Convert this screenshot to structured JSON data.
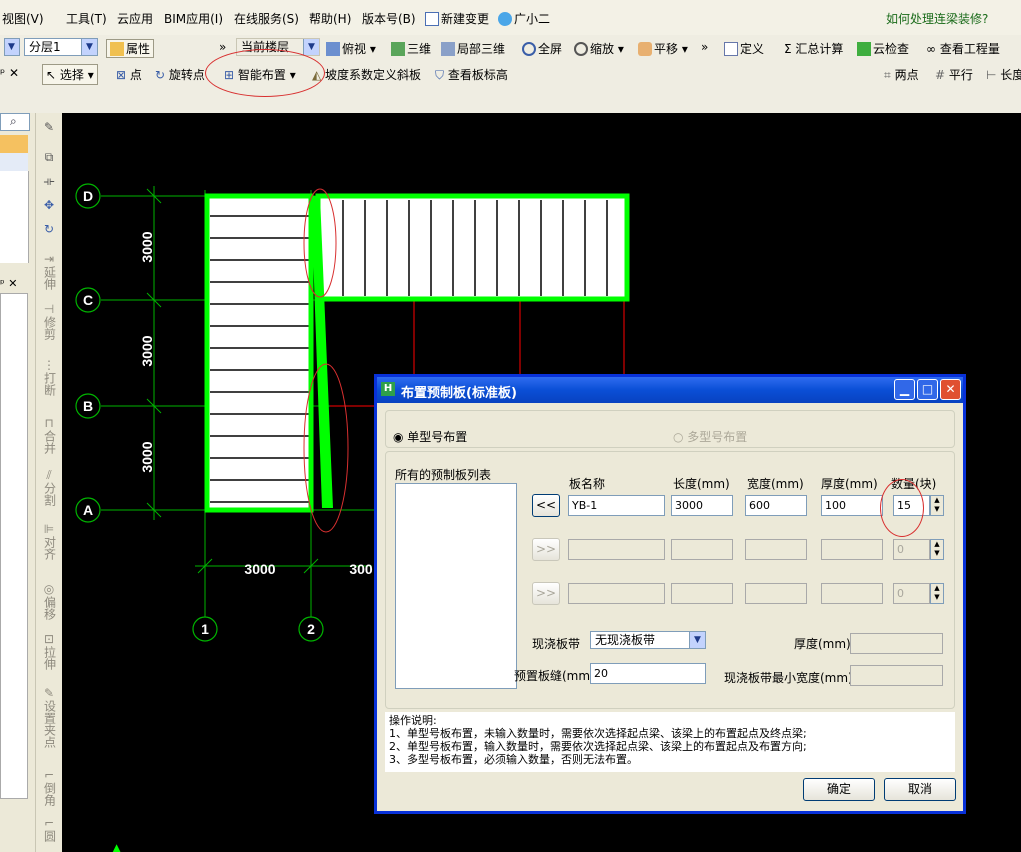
{
  "menu": {
    "items": [
      "视图(V)",
      "工具(T)",
      "云应用",
      "BIM应用(I)",
      "在线服务(S)",
      "帮助(H)",
      "版本号(B)",
      "新建变更",
      "广小二"
    ],
    "help_link": "如何处理连梁装修?"
  },
  "toolbar1": {
    "floor": "分层1",
    "properties": "属性",
    "current_floor": "当前楼层",
    "view_buttons": [
      "俯视",
      "三维",
      "局部三维",
      "全屏",
      "缩放",
      "平移"
    ],
    "right_buttons": [
      "定义",
      "汇总计算",
      "云检查",
      "查看工程量"
    ]
  },
  "toolbar2": {
    "select": "选择",
    "tools": [
      "点",
      "旋转点",
      "智能布置",
      "坡度系数定义斜板",
      "查看板标高"
    ],
    "right_tools": [
      "两点",
      "平行",
      "长度"
    ]
  },
  "side_tools": [
    "延伸",
    "修剪",
    "打断",
    "合并",
    "分割",
    "对齐",
    "偏移",
    "拉伸",
    "设置夹点",
    "倒角",
    "圆"
  ],
  "drawing": {
    "axes": [
      "D",
      "C",
      "B",
      "A",
      "1",
      "2"
    ],
    "dim_vertical": [
      "3000",
      "3000",
      "3000"
    ],
    "dim_horizontal": [
      "3000",
      "300"
    ]
  },
  "dialog": {
    "title": "布置预制板(标准板)",
    "single_mode": "单型号布置",
    "multi_mode": "多型号布置",
    "list_title": "所有的预制板列表",
    "col_name": "板名称",
    "col_length": "长度(mm)",
    "col_width": "宽度(mm)",
    "col_thickness": "厚度(mm)",
    "col_count": "数量(块)",
    "row1": {
      "btn": "<<",
      "name": "YB-1",
      "length": "3000",
      "width": "600",
      "thickness": "100",
      "count": "15"
    },
    "row2": {
      "btn": ">>",
      "count": "0"
    },
    "row3": {
      "btn": ">>",
      "count": "0"
    },
    "cast_band_label": "现浇板带",
    "cast_band_value": "无现浇板带",
    "thickness_label": "厚度(mm)",
    "gap_label": "预置板缝(mm)",
    "gap_value": "20",
    "min_width_label": "现浇板带最小宽度(mm)",
    "instructions": [
      "操作说明:",
      "1、单型号板布置，未输入数量时，需要依次选择起点梁、该梁上的布置起点及终点梁;",
      "2、单型号板布置，输入数量时，需要依次选择起点梁、该梁上的布置起点及布置方向;",
      "3、多型号板布置，必须输入数量，否则无法布置。"
    ],
    "ok": "确定",
    "cancel": "取消"
  },
  "colors": {
    "slab": "#00ff00",
    "grid": "#00b400",
    "beam": "#ff0000",
    "title_bar": "#0a4fd6",
    "annotation": "#d83030"
  }
}
